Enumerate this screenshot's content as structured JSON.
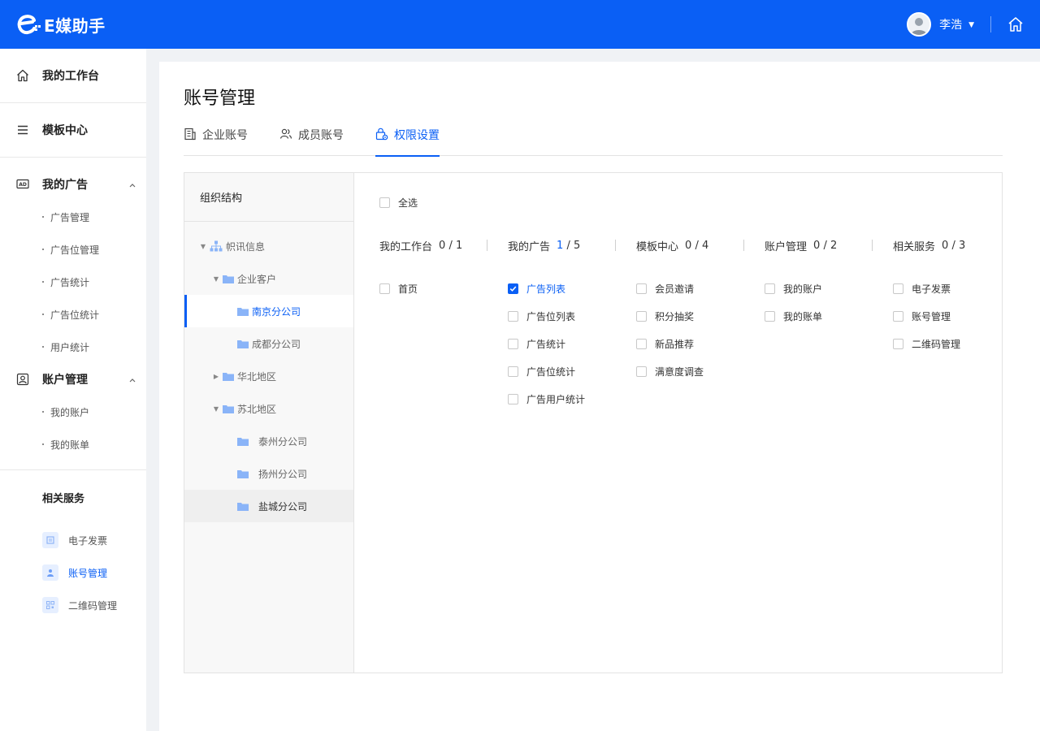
{
  "app": {
    "name": "E媒助手"
  },
  "header": {
    "username": "李浩"
  },
  "sidebar": {
    "workbench": "我的工作台",
    "templates": "模板中心",
    "ads": {
      "label": "我的广告",
      "items": [
        "广告管理",
        "广告位管理",
        "广告统计",
        "广告位统计",
        "用户统计"
      ]
    },
    "account": {
      "label": "账户管理",
      "items": [
        "我的账户",
        "我的账单"
      ]
    },
    "services": {
      "label": "相关服务",
      "items": [
        "电子发票",
        "账号管理",
        "二维码管理"
      ]
    }
  },
  "page": {
    "title": "账号管理",
    "tabs": [
      "企业账号",
      "成员账号",
      "权限设置"
    ],
    "active_tab": 2
  },
  "org": {
    "title": "组织结构",
    "nodes": [
      "帜讯信息",
      "企业客户",
      "南京分公司",
      "成都分公司",
      "华北地区",
      "苏北地区",
      "泰州分公司",
      "扬州分公司",
      "盐城分公司"
    ]
  },
  "permissions": {
    "select_all": "全选",
    "groups": [
      {
        "name": "我的工作台",
        "checked": "0",
        "total": "/ 1",
        "options": [
          "首页"
        ]
      },
      {
        "name": "我的广告",
        "checked": "1",
        "total": "/ 5",
        "options": [
          "广告列表",
          "广告位列表",
          "广告统计",
          "广告位统计",
          "广告用户统计"
        ]
      },
      {
        "name": "模板中心",
        "checked": "0",
        "total": "/ 4",
        "options": [
          "会员邀请",
          "积分抽奖",
          "新品推荐",
          "满意度调查"
        ]
      },
      {
        "name": "账户管理",
        "checked": "0",
        "total": "/ 2",
        "options": [
          "我的账户",
          "我的账单"
        ]
      },
      {
        "name": "相关服务",
        "checked": "0",
        "total": "/ 3",
        "options": [
          "电子发票",
          "账号管理",
          "二维码管理"
        ]
      }
    ]
  },
  "colors": {
    "primary": "#0a5ff5",
    "folder": "#8ab4f8"
  }
}
